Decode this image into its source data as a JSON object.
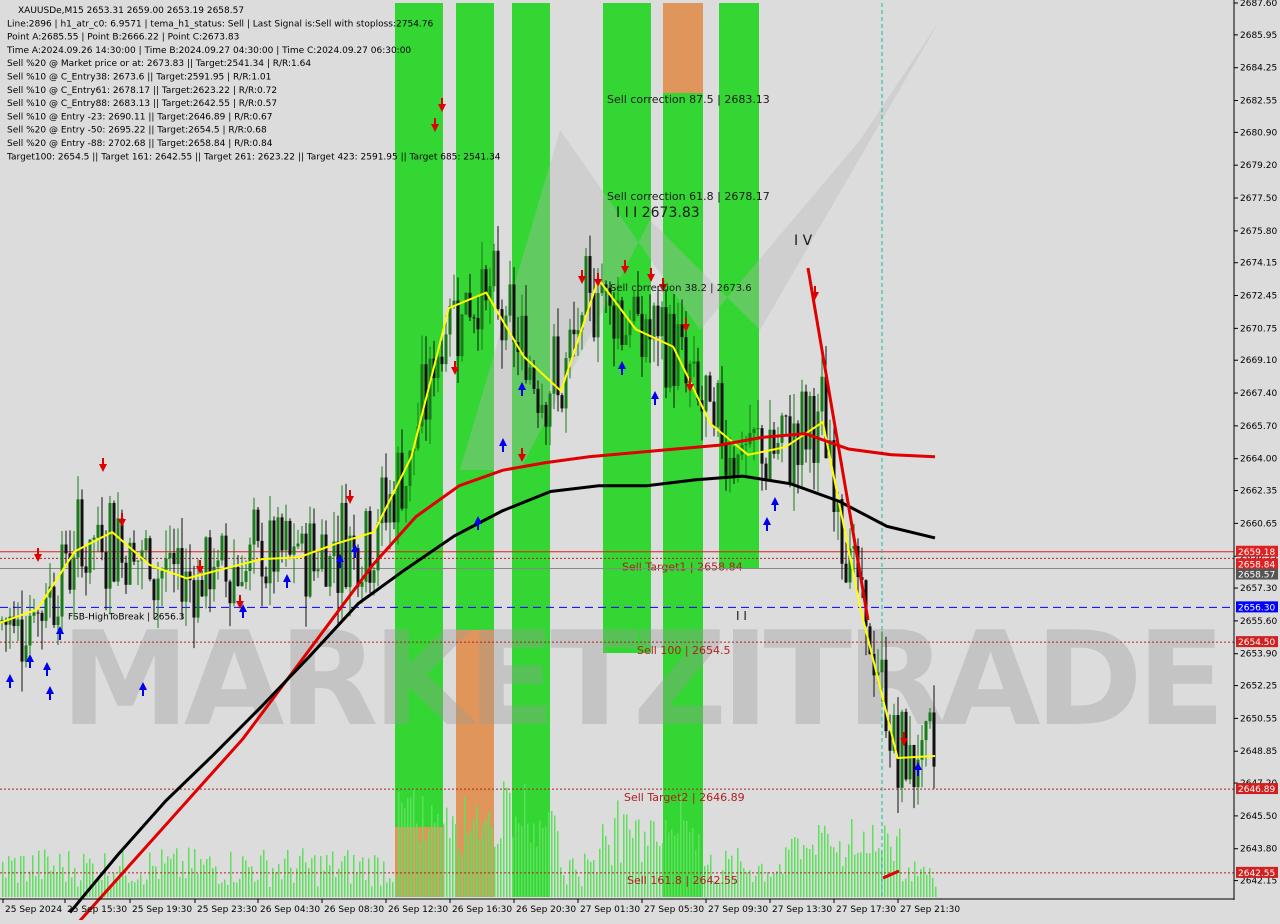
{
  "header": {
    "info_lines": [
      "XAUUSDe,M15  2653.31 2659.00 2653.19 2658.57",
      "Line:2896 | h1_atr_c0: 6.9571 | tema_h1_status: Sell | Last Signal is:Sell with stoploss:2754.76",
      "Point A:2685.55 | Point B:2666.22 | Point C:2673.83",
      "Time A:2024.09.26 14:30:00 | Time B:2024.09.27 04:30:00 | Time C:2024.09.27 06:30:00",
      "Sell %20 @ Market price or at: 2673.83 || Target:2541.34 | R/R:1.64",
      "Sell %10 @ C_Entry38: 2673.6 || Target:2591.95 | R/R:1.01",
      "Sell %10 @ C_Entry61: 2678.17 || Target:2623.22 | R/R:0.72",
      "Sell %10 @ C_Entry88: 2683.13 || Target:2642.55 | R/R:0.57",
      "Sell %10 @ Entry -23: 2690.11 || Target:2646.89 | R/R:0.67",
      "Sell %20 @ Entry -50: 2695.22 || Target:2654.5 | R/R:0.68",
      "Sell %20 @ Entry -88: 2702.68 || Target:2658.84 | R/R:0.84",
      "Target100: 2654.5 || Target 161: 2642.55 || Target 261: 2623.22 || Target 423: 2591.95 || Target 685: 2541.34"
    ]
  },
  "watermark": "MARKETZITRADE",
  "colors": {
    "background": "#dcdcdc",
    "green_zone": "#33d633",
    "orange_zone": "#e0965a",
    "bull_candle": "#1a7a1a",
    "bear_candle": "#111111",
    "ma_red": "#e00000",
    "ma_black": "#000000",
    "ma_yellow": "#ffff00",
    "blue_line": "#0000ff",
    "cyan_line": "#00c8a0",
    "volume": "#5ee05e",
    "level_red": "#b02020"
  },
  "chart_data": {
    "type": "candlestick",
    "symbol": "XAUUSDe",
    "timeframe": "M15",
    "ohlc_last": {
      "open": 2653.31,
      "high": 2659.0,
      "low": 2653.19,
      "close": 2658.57
    },
    "ylim": [
      2641.3,
      2687.6
    ],
    "y_ticks": [
      "2687.60",
      "2685.95",
      "2684.25",
      "2682.55",
      "2680.90",
      "2679.20",
      "2677.50",
      "2675.80",
      "2674.15",
      "2672.45",
      "2670.75",
      "2669.10",
      "2667.40",
      "2665.70",
      "2664.00",
      "2662.35",
      "2660.65",
      "2658.95",
      "2657.30",
      "2655.60",
      "2653.90",
      "2652.25",
      "2650.55",
      "2648.85",
      "2647.20",
      "2645.50",
      "2643.80",
      "2642.15"
    ],
    "x_ticks": [
      "25 Sep 2024",
      "25 Sep 15:30",
      "25 Sep 19:30",
      "25 Sep 23:30",
      "26 Sep 04:30",
      "26 Sep 08:30",
      "26 Sep 12:30",
      "26 Sep 16:30",
      "26 Sep 20:30",
      "27 Sep 01:30",
      "27 Sep 05:30",
      "27 Sep 09:30",
      "27 Sep 13:30",
      "27 Sep 17:30",
      "27 Sep 21:30"
    ],
    "price_tags": [
      {
        "label": "2659.18",
        "price": 2659.18,
        "color": "#e02020"
      },
      {
        "label": "2658.84",
        "price": 2658.84,
        "color": "#e02020"
      },
      {
        "label": "2658.57",
        "price": 2658.57,
        "color": "#555555"
      },
      {
        "label": "2656.30",
        "price": 2656.3,
        "color": "#0000ff"
      },
      {
        "label": "2654.50",
        "price": 2654.5,
        "color": "#d02020"
      },
      {
        "label": "2646.89",
        "price": 2646.89,
        "color": "#d02020"
      },
      {
        "label": "2642.55",
        "price": 2642.55,
        "color": "#d02020"
      }
    ],
    "levels": [
      {
        "price": 2658.84,
        "label": "Sell Target1 | 2658.84",
        "style": "dotted",
        "color": "#b02020"
      },
      {
        "price": 2654.5,
        "label": "Sell 100 | 2654.5",
        "style": "dotted",
        "color": "#b02020"
      },
      {
        "price": 2646.89,
        "label": "Sell Target2 | 2646.89",
        "style": "dotted",
        "color": "#b02020"
      },
      {
        "price": 2642.55,
        "label": "Sell 161.8 | 2642.55",
        "style": "dotted",
        "color": "#b02020"
      },
      {
        "price": 2656.3,
        "label": "FSB-HighToBreak | 2656.3",
        "style": "dashed",
        "color": "#0000ff"
      }
    ],
    "annotations": [
      {
        "text": "Sell correction 87.5 | 2683.13",
        "price": 2683.13
      },
      {
        "text": "Sell correction 61.8 | 2678.17",
        "price": 2678.17
      },
      {
        "text": "I I I 2673.83",
        "price": 2673.83
      },
      {
        "text": "Sell correction 38.2 | 2673.6",
        "price": 2673.6
      },
      {
        "text": "I V",
        "price": 2675.8
      },
      {
        "text": "I I",
        "price": 2656.6
      }
    ],
    "ma_red": [
      [
        2639.5,
        2642,
        2644.5,
        2647,
        2649.5,
        2652.5,
        2655.5,
        2658.5,
        2661,
        2662.6,
        2663.4,
        2663.8,
        2664.1,
        2664.3,
        2664.5,
        2664.7,
        2665.1,
        2665.3,
        2664.5,
        2664.2,
        2664.1
      ]
    ],
    "ma_black": [
      [
        2640.5,
        2643.5,
        2646.3,
        2648.7,
        2651.2,
        2653.8,
        2656.5,
        2658.3,
        2660,
        2661.3,
        2662.3,
        2662.6,
        2662.6,
        2662.9,
        2663.1,
        2662.7,
        2661.8,
        2660.5,
        2659.9
      ]
    ],
    "ma_yellow": [
      [
        2655.5,
        2656.2,
        2659.2,
        2660.2,
        2658.5,
        2657.8,
        2658.3,
        2658.8,
        2658.9,
        2659.6,
        2660.2,
        2664.1,
        2671.8,
        2672.6,
        2669.3,
        2667.5,
        2673.3,
        2670.7,
        2669.8,
        2665.8,
        2664.2,
        2664.6,
        2665.9,
        2656.3,
        2648.5,
        2648.6
      ]
    ]
  }
}
